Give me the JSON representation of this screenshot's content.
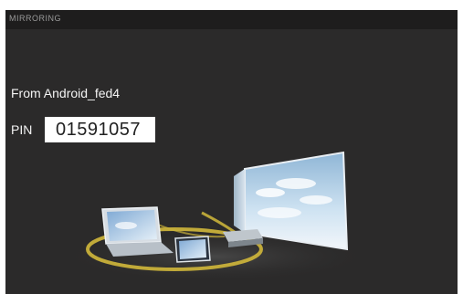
{
  "window": {
    "title": "MIRRORING"
  },
  "connection": {
    "from_text": "From Android_fed4",
    "pin_label": "PIN",
    "pin_value": "01591057"
  },
  "illustration": {
    "icons": [
      "laptop-icon",
      "tablet-icon",
      "router-icon",
      "tv-screen-icon"
    ],
    "colors": {
      "ring": "#c9b13a",
      "sky": "#a9cde8",
      "background": "#2b2a2a"
    }
  }
}
